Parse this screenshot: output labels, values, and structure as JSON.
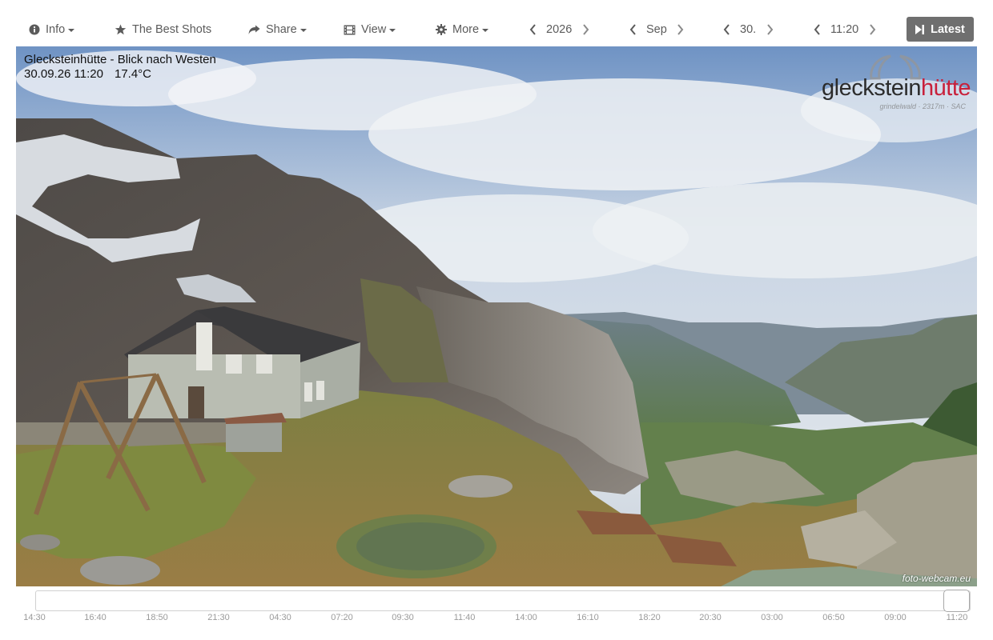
{
  "toolbar": {
    "info_label": "Info",
    "best_shots_label": "The Best Shots",
    "share_label": "Share",
    "view_label": "View",
    "more_label": "More",
    "year": "2026",
    "month": "Sep",
    "day": "30.",
    "time": "11:20",
    "latest_label": "Latest"
  },
  "webcam": {
    "title": "Glecksteinhütte - Blick nach Westen",
    "datetime": "30.09.26 11:20",
    "temperature": "17.4°C",
    "logo_main": "gleckstein",
    "logo_accent": "hütte",
    "logo_tagline": "grindelwald · 2317m · SAC",
    "credit": "foto-webcam.eu"
  },
  "timeline": {
    "position": 1.0,
    "ticks": [
      "14:30",
      "16:40",
      "18:50",
      "21:30",
      "04:30",
      "07:20",
      "09:30",
      "11:40",
      "14:00",
      "16:10",
      "18:20",
      "20:30",
      "03:00",
      "06:50",
      "09:00",
      "11:20"
    ]
  },
  "colors": {
    "accent_button": "#6f6f6f",
    "logo_red": "#c8203b",
    "toolbar_text": "#5b5b5b"
  }
}
